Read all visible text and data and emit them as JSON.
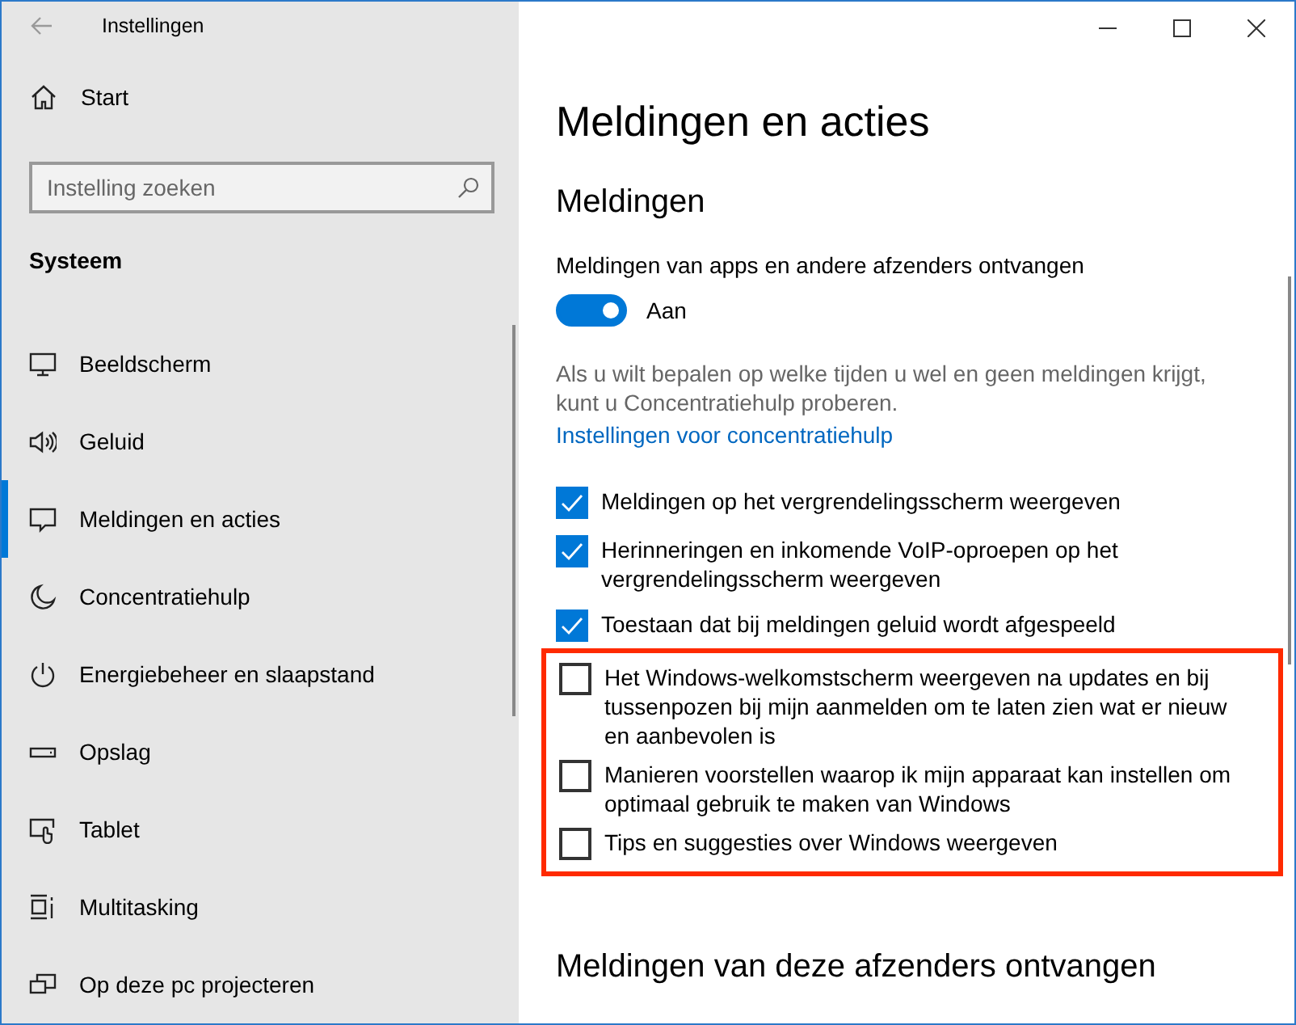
{
  "window": {
    "title": "Instellingen"
  },
  "sidebar": {
    "home": "Start",
    "search": {
      "placeholder": "Instelling zoeken"
    },
    "section": "Systeem",
    "items": [
      {
        "label": "Beeldscherm",
        "kind": "display",
        "selected": false
      },
      {
        "label": "Geluid",
        "kind": "sound",
        "selected": false
      },
      {
        "label": "Meldingen en acties",
        "kind": "notifications",
        "selected": true
      },
      {
        "label": "Concentratiehulp",
        "kind": "focus",
        "selected": false
      },
      {
        "label": "Energiebeheer en slaapstand",
        "kind": "power",
        "selected": false
      },
      {
        "label": "Opslag",
        "kind": "storage",
        "selected": false
      },
      {
        "label": "Tablet",
        "kind": "tablet",
        "selected": false
      },
      {
        "label": "Multitasking",
        "kind": "multitasking",
        "selected": false
      },
      {
        "label": "Op deze pc projecteren",
        "kind": "project",
        "selected": false
      }
    ]
  },
  "page": {
    "title": "Meldingen en acties",
    "section": "Meldingen",
    "toggle": {
      "label": "Meldingen van apps en andere afzenders ontvangen",
      "on": true,
      "state_text": "Aan"
    },
    "description": "Als u wilt bepalen op welke tijden u wel en geen meldingen krijgt, kunt u Concentratiehulp proberen.",
    "link": "Instellingen voor concentratiehulp",
    "options": [
      {
        "label": "Meldingen op het vergrendelingsscherm weergeven",
        "checked": true
      },
      {
        "label": "Herinneringen en inkomende VoIP-oproepen op het vergrendelingsscherm weergeven",
        "checked": true
      },
      {
        "label": "Toestaan dat bij meldingen geluid wordt afgespeeld",
        "checked": true
      }
    ],
    "highlighted_options": [
      {
        "label": "Het Windows-welkomstscherm weergeven na updates en bij tussenpozen bij mijn aanmelden om te laten zien wat er nieuw en aanbevolen is",
        "checked": false
      },
      {
        "label": "Manieren voorstellen waarop ik mijn apparaat kan instellen om optimaal gebruik te maken van Windows",
        "checked": false
      },
      {
        "label": "Tips en suggesties over Windows weergeven",
        "checked": false
      }
    ],
    "next_section": "Meldingen van deze afzenders ontvangen"
  }
}
